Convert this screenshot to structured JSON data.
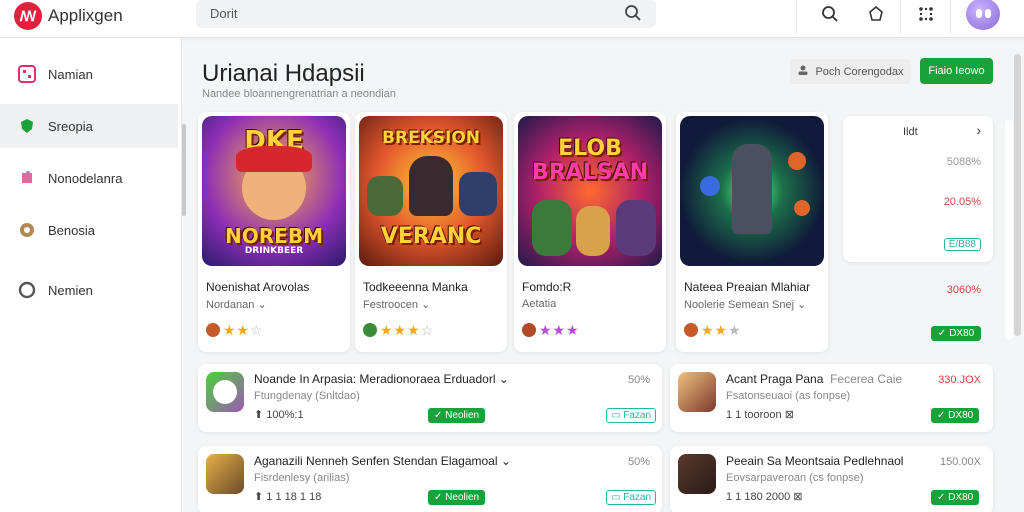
{
  "app": {
    "brand": "Applixgen"
  },
  "search": {
    "placeholder": "Dorit"
  },
  "sidebar": {
    "items": [
      {
        "label": "Namian",
        "icon": "grid-icon"
      },
      {
        "label": "Sreopia",
        "icon": "shield-icon"
      },
      {
        "label": "Nonodelanra",
        "icon": "puzzle-icon"
      },
      {
        "label": "Benosia",
        "icon": "chat-icon"
      },
      {
        "label": "Nemien",
        "icon": "circle-icon"
      }
    ]
  },
  "header": {
    "title": "Urianai Hdapsii",
    "subtitle": "Nandee bloannengrenatrian a neondian",
    "secondary_button": "Poch Corengodax",
    "primary_button": "Fiaio Ieowo"
  },
  "cards": [
    {
      "name": "Noenishat Arovolas",
      "category": "Nordanan",
      "thumb_text_top": "DKE",
      "thumb_text_bottom": "NOREBM",
      "thumb_text_tag": "DRINKBEER",
      "rating": 2
    },
    {
      "name": "Todkeeenna Manka",
      "category": "Festroocen",
      "thumb_text_top": "BREKSION",
      "thumb_text_bottom": "VERANC",
      "thumb_text_tag": "",
      "rating": 3
    },
    {
      "name": "Fomdo:R",
      "category": "Aetatia",
      "thumb_text_top": "ELOB",
      "thumb_text_bottom": "BRALSAN",
      "thumb_text_tag": "",
      "rating": 3
    },
    {
      "name": "Nateea Preaian Mlahiar",
      "category": "Noolerie Semean Snej",
      "thumb_text_top": "",
      "thumb_text_bottom": "",
      "thumb_text_tag": "",
      "rating": 3
    }
  ],
  "stats": {
    "header": "Ildt",
    "value1": "5088%",
    "value2": "20.05%",
    "value3": "E/B88",
    "value4": "3060%",
    "tag": "DX80"
  },
  "rows": [
    {
      "name": "Noande In Arpasia: Meradionoraea Erduadorl",
      "sub": "Ftungdenay (Snltdao)",
      "meta": "100%:1",
      "price": "50%",
      "tag": "Neolien",
      "tag2": "Fazan",
      "price_red": false
    },
    {
      "name": "Acant Praga Pana",
      "name2": "Fecerea Caie",
      "sub": "Fsatonseuaoi (as fonpse)",
      "meta": "1 1 tooroon",
      "price": "330.JOX",
      "tag": "DX80",
      "price_red": true
    },
    {
      "name": "Aganazili Nenneh Senfen Stendan Elagamoal",
      "sub": "Fisrdenlesy (arilias)",
      "meta": "1 1 18 1 18",
      "price": "50%",
      "tag": "Neolien",
      "tag2": "Fazan",
      "price_red": false
    },
    {
      "name": "Peeain Sa Meontsaia Pedlehnaol",
      "sub": "Eovsarpaveroan (cs fonpse)",
      "meta": "1 1 180 2000",
      "price": "150.00X",
      "tag": "DX80",
      "price_red": false
    }
  ],
  "colors": {
    "accent_green": "#1aa23a",
    "logo_red": "#e0223d",
    "teal": "#2bb3a8",
    "red_text": "#d64545"
  }
}
